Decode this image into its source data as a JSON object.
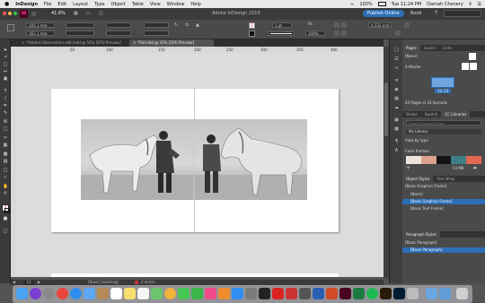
{
  "menubar": {
    "apple": "",
    "app": "InDesign",
    "menus": [
      "File",
      "Edit",
      "Layout",
      "Type",
      "Object",
      "Table",
      "View",
      "Window",
      "Help"
    ],
    "battery": "100%",
    "time": "Tue 11:24 PM",
    "user": "Oamah Chenery"
  },
  "appbar": {
    "logo": "Id",
    "zoom": "41.6%",
    "title": "Adobe InDesign 2019",
    "publish_label": "Publish Online",
    "workspace": "Book"
  },
  "toolbar": {
    "x_value": "101.1 mm",
    "y_value": "161.1 mm",
    "w_value": "",
    "h_value": "",
    "stroke_weight": "1 pt",
    "opacity": "100%",
    "offset": "4.233 mm"
  },
  "tabs": [
    {
      "label": "*Patient Observation edit.indd @ 54% [GPU Preview]",
      "active": false
    },
    {
      "label": "*Fel.indd @ 42% [GPU Preview]",
      "active": true
    }
  ],
  "ruler_marks": [
    "50",
    "100",
    "150",
    "200",
    "250",
    "300",
    "350",
    "400"
  ],
  "status": {
    "page": "12",
    "style": "[Basic] (working)",
    "errors": "2 errors"
  },
  "pages_panel": {
    "tabs": [
      "Pages",
      "Layers",
      "Links"
    ],
    "none_label": "[None]",
    "master_label": "A-Master",
    "spread_label": "12–13",
    "summary": "44 Pages in 23 Spreads"
  },
  "libraries_panel": {
    "tabs": [
      "Stroke",
      "Swatch",
      "CC Libraries"
    ],
    "search_placeholder": "Search Current Library",
    "library": "My Library",
    "view_by": "View by type",
    "section": "Color themes",
    "size_note": "54 MB"
  },
  "object_styles_panel": {
    "tabs": [
      "Object Styles",
      "Text Wrap"
    ],
    "current": "[Basic Graphics Frame]",
    "items": [
      "[None]",
      "[Basic Graphics Frame]",
      "[Basic Text Frame]"
    ],
    "selected_index": 1
  },
  "paragraph_styles_panel": {
    "title": "Paragraph Styles",
    "current": "[Basic Paragraph]",
    "items": [
      "[Basic Paragraph]"
    ]
  },
  "colors": {
    "accent": "#2d6fb7",
    "swatches": [
      "#efe4dc",
      "#d9a38c",
      "#141414",
      "#3c7f86",
      "#e06a4f"
    ]
  }
}
